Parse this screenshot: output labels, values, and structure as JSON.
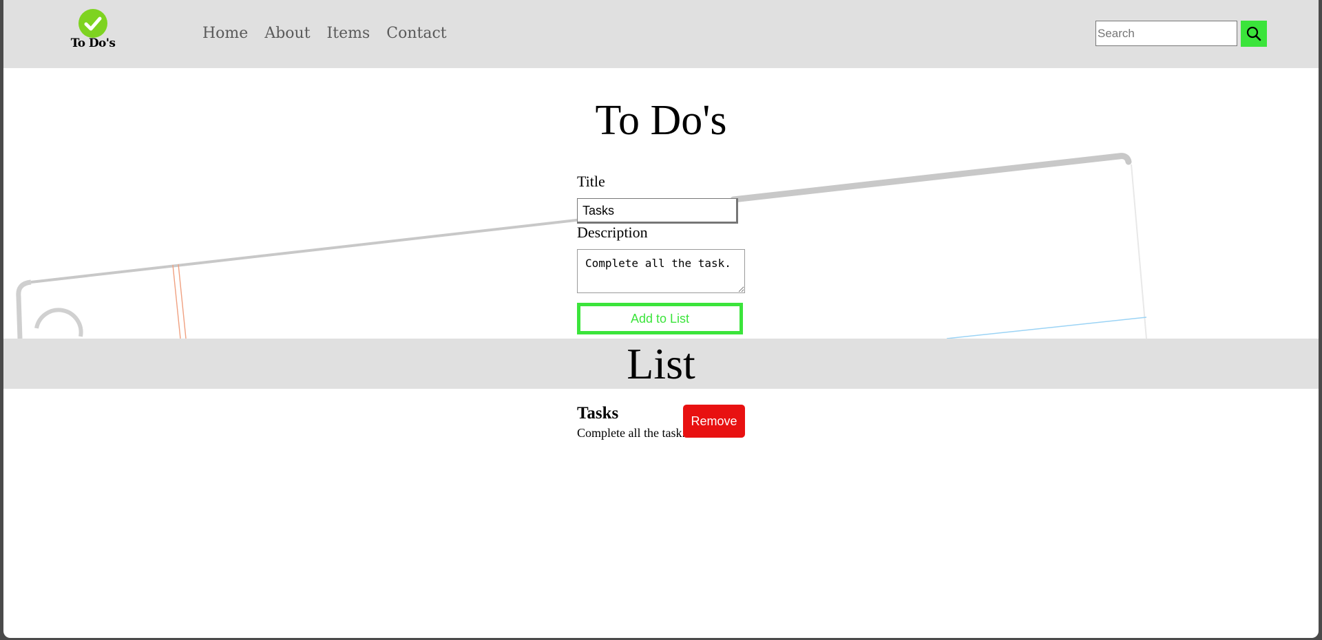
{
  "nav": {
    "logo_text": "To Do's",
    "links": [
      {
        "label": "Home"
      },
      {
        "label": "About"
      },
      {
        "label": "Items"
      },
      {
        "label": "Contact"
      }
    ],
    "search": {
      "placeholder": "Search",
      "value": ""
    },
    "search_icon": "search-icon",
    "logo_icon": "check-circle-icon"
  },
  "form": {
    "heading": "To Do's",
    "title_label": "Title",
    "title_value": "Tasks",
    "description_label": "Description",
    "description_value": "Complete all the task.",
    "add_label": "Add to List"
  },
  "list": {
    "heading": "List",
    "items": [
      {
        "title": "Tasks",
        "description": "Complete all the task.",
        "remove_label": "Remove"
      }
    ]
  },
  "colors": {
    "navbar": "#e0e0e0",
    "accent_green": "#3be43b",
    "logo_green": "#7ed321",
    "remove_red": "#e81111"
  }
}
